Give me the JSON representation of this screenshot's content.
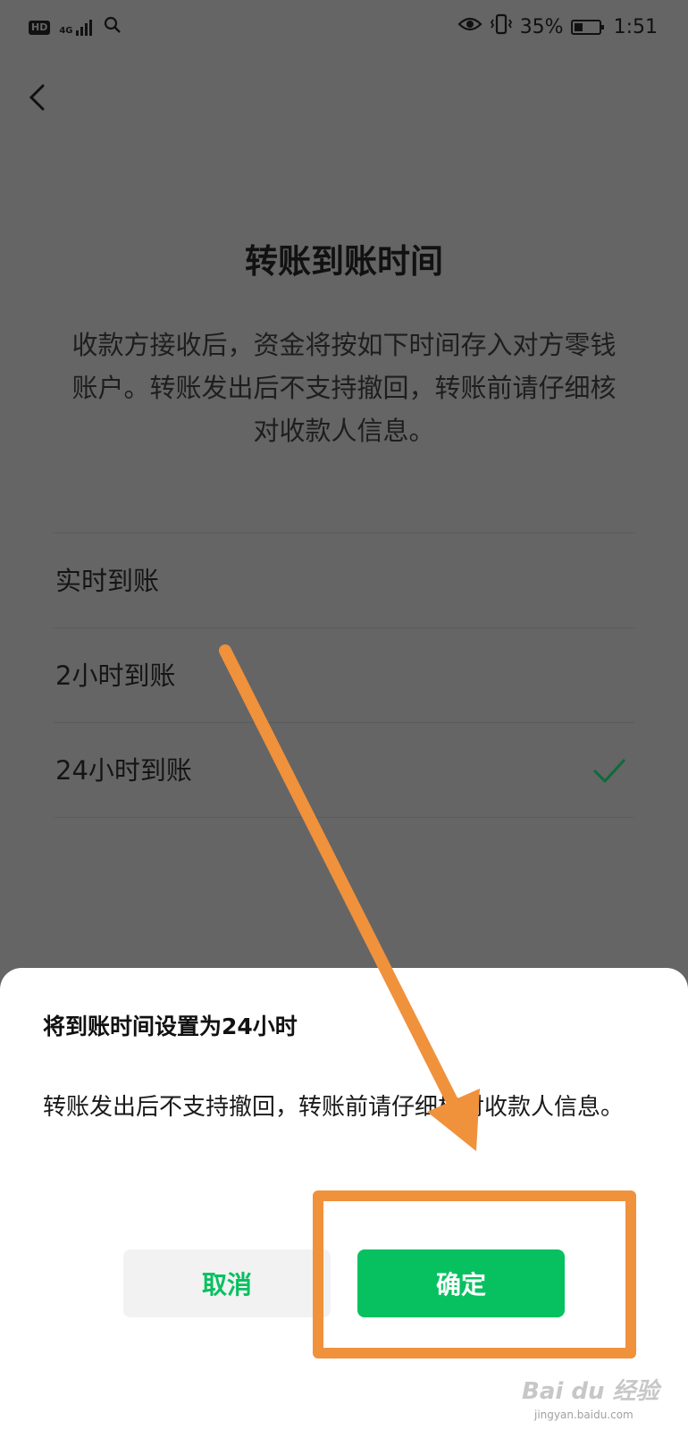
{
  "status_bar": {
    "hd": "HD",
    "network": "4G",
    "battery": "35%",
    "time": "1:51"
  },
  "page": {
    "title": "转账到账时间",
    "description": "收款方接收后，资金将按如下时间存入对方零钱账户。转账发出后不支持撤回，转账前请仔细核对收款人信息。",
    "options": [
      {
        "label": "实时到账",
        "selected": false
      },
      {
        "label": "2小时到账",
        "selected": false
      },
      {
        "label": "24小时到账",
        "selected": true
      }
    ]
  },
  "dialog": {
    "title": "将到账时间设置为24小时",
    "message": "转账发出后不支持撤回，转账前请仔细核对收款人信息。",
    "cancel_label": "取消",
    "confirm_label": "确定"
  },
  "annotation": {
    "highlight_color": "#f0913c"
  },
  "colors": {
    "accent_green": "#07c160",
    "overlay": "#656565"
  },
  "watermark": {
    "brand": "Bai du 经验",
    "url": "jingyan.baidu.com"
  }
}
